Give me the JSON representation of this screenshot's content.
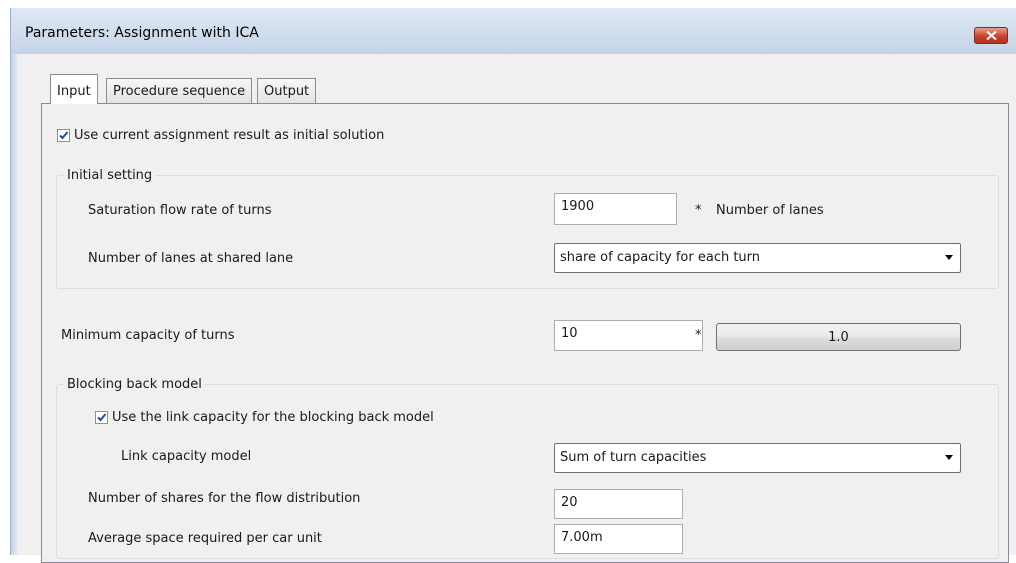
{
  "window": {
    "title": "Parameters: Assignment with ICA"
  },
  "tabs": [
    {
      "label": "Input"
    },
    {
      "label": "Procedure sequence"
    },
    {
      "label": "Output"
    }
  ],
  "input": {
    "use_current_assignment": {
      "label": "Use current assignment result as initial solution",
      "checked": true
    },
    "initial_setting": {
      "title": "Initial setting",
      "saturation_flow": {
        "label": "Saturation flow rate of turns",
        "value": "1900",
        "operator": "*",
        "suffix": "Number of lanes"
      },
      "lanes_shared": {
        "label": "Number of lanes at shared lane",
        "selected": "share of capacity for each turn"
      }
    },
    "min_capacity": {
      "label": "Minimum capacity of turns",
      "value": "10",
      "operator": "*",
      "button": "1.0"
    },
    "blocking_back": {
      "title": "Blocking back model",
      "use_link_capacity": {
        "label": "Use the link capacity for the blocking back model",
        "checked": true
      },
      "link_capacity_model": {
        "label": "Link capacity model",
        "selected": "Sum of turn capacities"
      },
      "num_shares": {
        "label": "Number of shares for the flow distribution",
        "value": "20"
      },
      "avg_space": {
        "label": "Average space required per car unit",
        "value": "7.00m"
      }
    }
  },
  "icons": {
    "close": "close-x-icon",
    "check": "checkmark-icon",
    "dropdown": "chevron-down-icon"
  }
}
